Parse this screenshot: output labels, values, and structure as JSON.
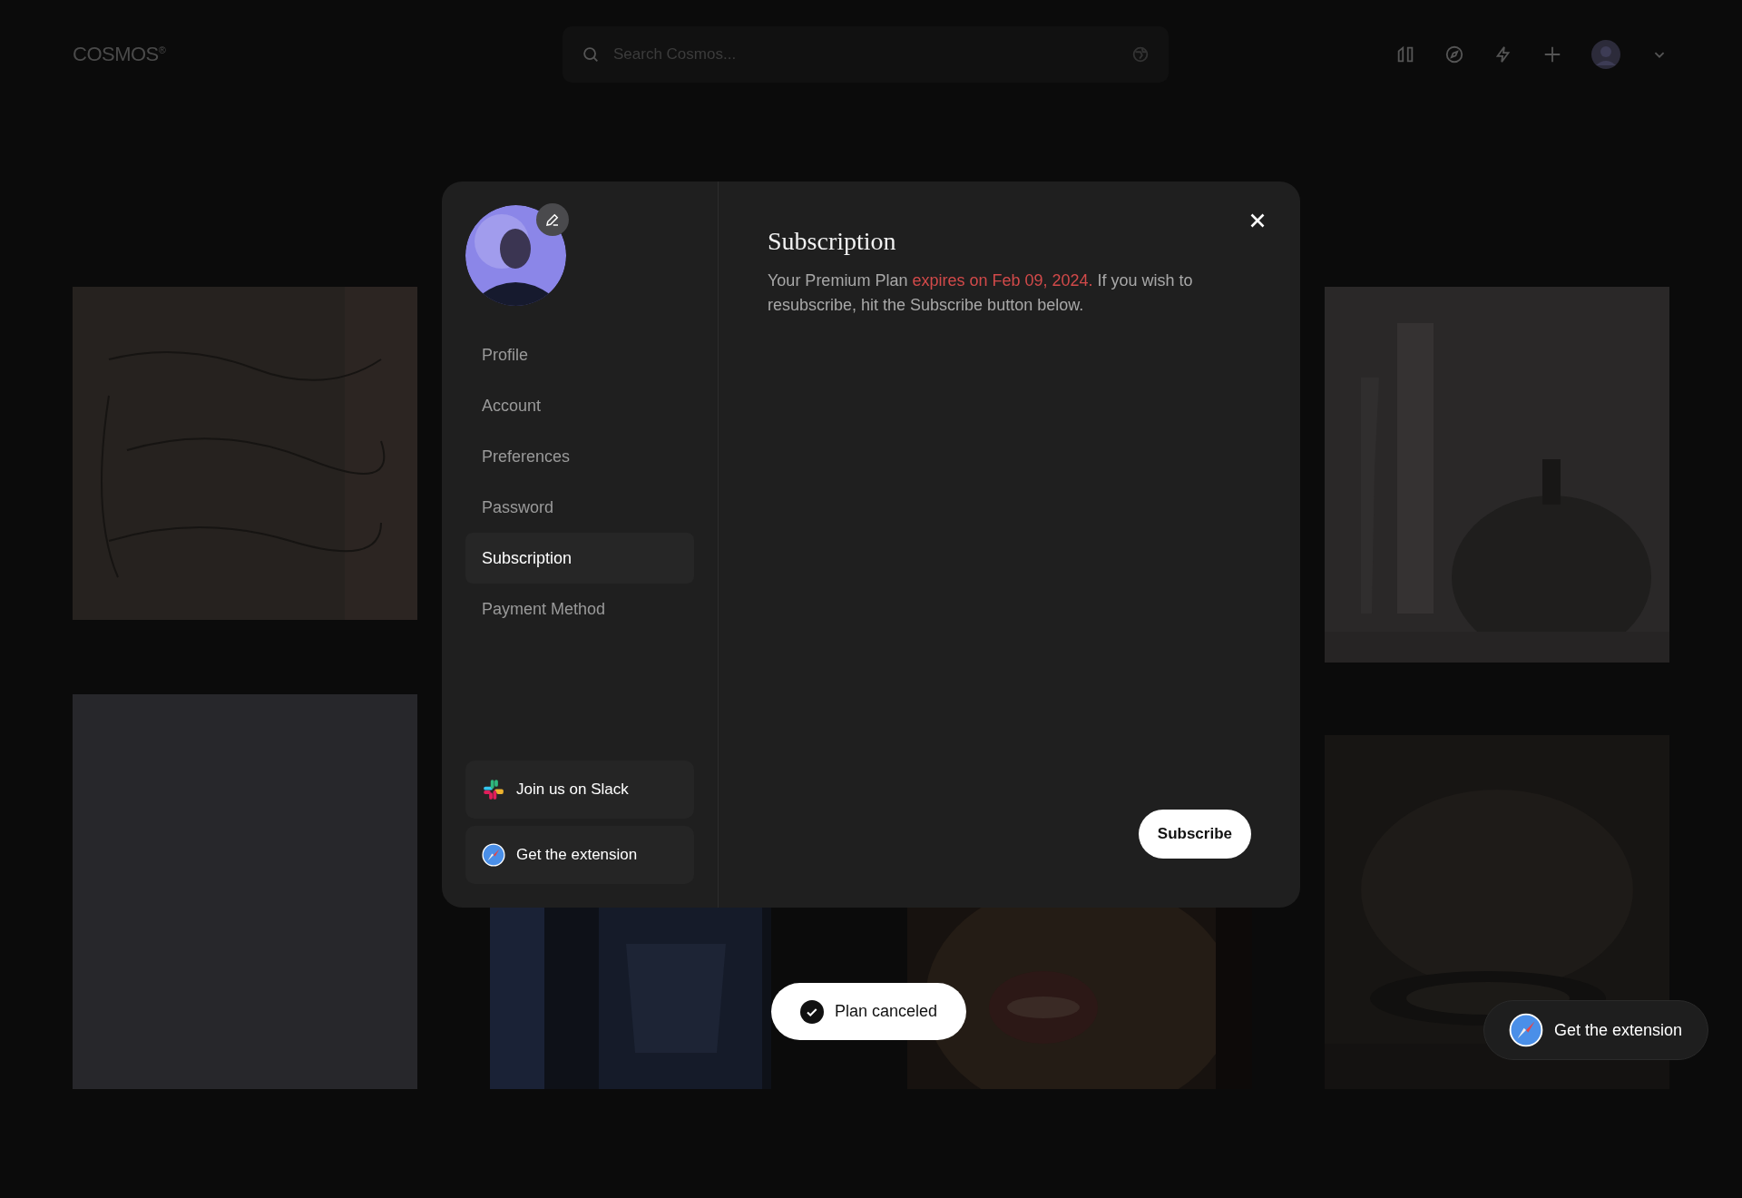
{
  "header": {
    "logo": "COSMOS",
    "logo_mark": "®",
    "search": {
      "placeholder": "Search Cosmos..."
    }
  },
  "modal": {
    "nav": [
      {
        "label": "Profile",
        "selected": false
      },
      {
        "label": "Account",
        "selected": false
      },
      {
        "label": "Preferences",
        "selected": false
      },
      {
        "label": "Password",
        "selected": false
      },
      {
        "label": "Subscription",
        "selected": true
      },
      {
        "label": "Payment Method",
        "selected": false
      }
    ],
    "links": [
      {
        "kind": "slack",
        "label": "Join us on Slack"
      },
      {
        "kind": "extension",
        "label": "Get the extension"
      }
    ],
    "title": "Subscription",
    "message": [
      {
        "text": "Your Premium Plan ",
        "highlight": false
      },
      {
        "text": "expires on Feb 09, 2024.",
        "highlight": true
      },
      {
        "text": " If you wish to resubscribe, hit the Subscribe button below.",
        "highlight": false
      }
    ],
    "button": "Subscribe"
  },
  "toast": {
    "text": "Plan canceled"
  },
  "extension_button": {
    "label": "Get the extension"
  }
}
